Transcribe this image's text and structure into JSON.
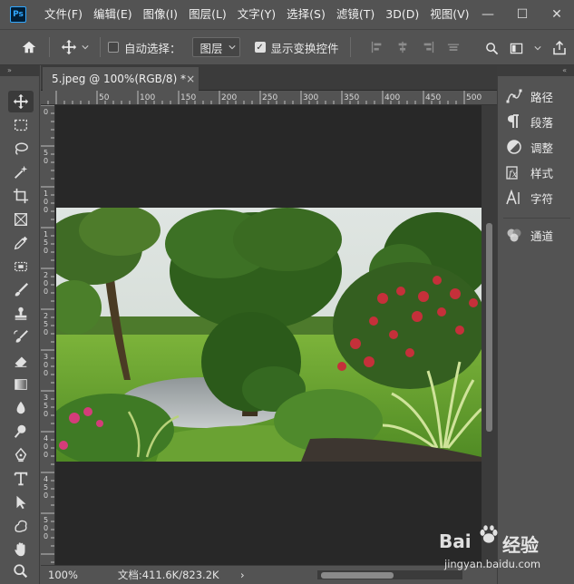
{
  "app": {
    "logo_text": "Ps"
  },
  "menu": {
    "items": [
      "文件(F)",
      "编辑(E)",
      "图像(I)",
      "图层(L)",
      "文字(Y)",
      "选择(S)",
      "滤镜(T)",
      "3D(D)",
      "视图(V)"
    ]
  },
  "window_controls": {
    "minimize": "—",
    "maximize": "☐",
    "close": "✕"
  },
  "options_bar": {
    "auto_select_label": "自动选择：",
    "auto_select_checked": false,
    "layer_select_value": "图层",
    "show_transform_label": "显示变换控件",
    "show_transform_checked": true
  },
  "document": {
    "tab_title": "5.jpeg @ 100%(RGB/8) *",
    "tab_close": "×",
    "zoom": "100%",
    "doc_info": "文档:411.6K/823.2K",
    "status_arrow": "›"
  },
  "ruler": {
    "h_labels": [
      "50",
      "100",
      "150",
      "200",
      "250",
      "300",
      "350",
      "400",
      "450",
      "500"
    ],
    "v_labels": [
      "0",
      "5 0",
      "1 0 0",
      "1 5 0",
      "2 0 0",
      "2 5 0",
      "3 0 0",
      "3 5 0",
      "4 0 0",
      "4 5 0",
      "5 0 0"
    ]
  },
  "panels": {
    "items": [
      {
        "label": "路径",
        "icon": "paths-icon"
      },
      {
        "label": "段落",
        "icon": "paragraph-icon"
      },
      {
        "label": "调整",
        "icon": "adjustments-icon"
      },
      {
        "label": "样式",
        "icon": "styles-icon"
      },
      {
        "label": "字符",
        "icon": "character-icon"
      },
      {
        "label": "通道",
        "icon": "channels-icon"
      }
    ]
  },
  "tools": [
    "move-tool",
    "marquee-tool",
    "lasso-tool",
    "magic-wand-tool",
    "crop-tool",
    "frame-tool",
    "eyedropper-tool",
    "healing-brush-tool",
    "brush-tool",
    "clone-stamp-tool",
    "history-brush-tool",
    "eraser-tool",
    "gradient-tool",
    "blur-tool",
    "dodge-tool",
    "pen-tool",
    "type-tool",
    "path-selection-tool",
    "custom-shape-tool",
    "hand-tool",
    "zoom-tool"
  ],
  "watermark": {
    "brand_latin": "Bai",
    "brand_cn": "经验",
    "url": "jingyan.baidu.com"
  },
  "colors": {
    "ui_bg": "#535353",
    "canvas_bg": "#282828",
    "accent": "#31a8ff"
  }
}
